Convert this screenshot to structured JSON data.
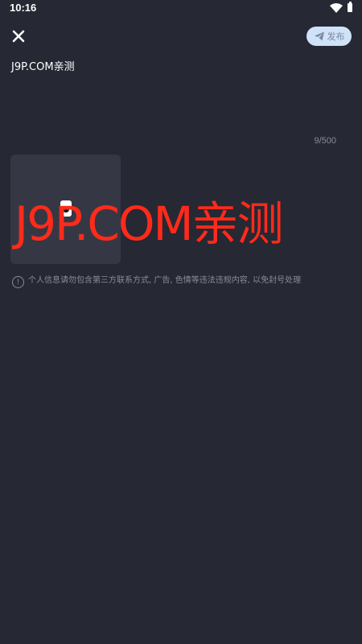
{
  "status_bar": {
    "time": "10:16",
    "icons": [
      "wifi-icon",
      "battery-icon"
    ]
  },
  "header": {
    "close_icon": "close-icon",
    "publish_label": "发布",
    "publish_icon": "send-icon",
    "publish_bg_color": "#cfe2f8"
  },
  "composer": {
    "text": "J9P.COM亲测",
    "char_count": "9/500"
  },
  "attachment": {
    "thumbnail_icon": "image-thumbnail"
  },
  "watermark": {
    "text": "J9P.COM亲测",
    "color": "#ff2a1a"
  },
  "notice": {
    "icon": "info-icon",
    "icon_glyph": "!",
    "text": "个人信息请勿包含第三方联系方式, 广告, 色情等违法违规内容, 以免封号处理"
  },
  "theme": {
    "background": "#262833",
    "secondary_text": "#8a8d98"
  }
}
